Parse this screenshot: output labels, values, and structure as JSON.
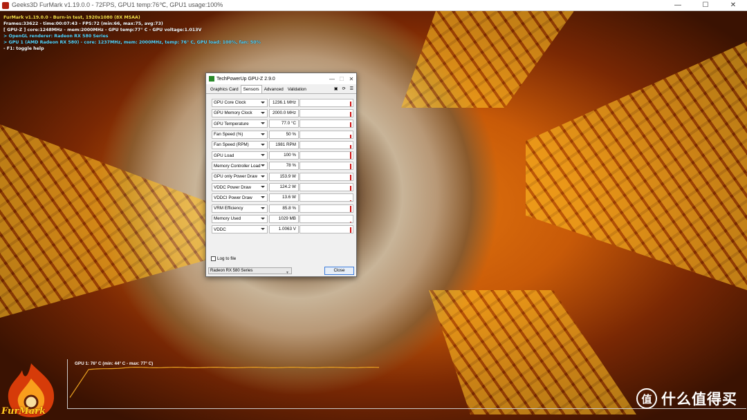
{
  "window": {
    "title": "Geeks3D FurMark v1.19.0.0 - 72FPS, GPU1 temp:76℃, GPU1 usage:100%",
    "controls": [
      "—",
      "☐",
      "✕"
    ]
  },
  "overlay": {
    "lines": [
      "FurMark v1.19.0.0 - Burn-in test, 1920x1080 (8X MSAA)",
      "Frames:33622 - time:00:07:43 - FPS:72 (min:66, max:75, avg:73)",
      "[ GPU-Z ] core:1248MHz - mem:2000MHz - GPU temp:77° C - GPU voltage:1.013V",
      "> OpenGL renderer: Radeon RX 580 Series",
      "> GPU 1 (AMD Radeon RX 580) - core: 1237MHz, mem: 2000MHz, temp: 76° C, GPU load: 100%, fan: 50%",
      "- F1: toggle help"
    ]
  },
  "gpuz": {
    "title": "TechPowerUp GPU-Z 2.9.0",
    "tabs": [
      "Graphics Card",
      "Sensors",
      "Advanced",
      "Validation"
    ],
    "active_tab": "Sensors",
    "sensors": [
      {
        "name": "GPU Core Clock",
        "value": "1236.1 MHz",
        "level": 0.7
      },
      {
        "name": "GPU Memory Clock",
        "value": "2000.0 MHz",
        "level": 0.7
      },
      {
        "name": "GPU Temperature",
        "value": "77.0 °C",
        "level": 0.7
      },
      {
        "name": "Fan Speed (%)",
        "value": "50 %",
        "level": 0.5
      },
      {
        "name": "Fan Speed (RPM)",
        "value": "1981 RPM",
        "level": 0.5
      },
      {
        "name": "GPU Load",
        "value": "100 %",
        "level": 1.0
      },
      {
        "name": "Memory Controller Load",
        "value": "78 %",
        "level": 0.78
      },
      {
        "name": "GPU only Power Draw",
        "value": "153.9 W",
        "level": 0.8
      },
      {
        "name": "VDDC Power Draw",
        "value": "124.2 W",
        "level": 0.7
      },
      {
        "name": "VDDCI Power Draw",
        "value": "13.6 W",
        "level": 0.1
      },
      {
        "name": "VRM Efficiency",
        "value": "85.8 %",
        "level": 0.85
      },
      {
        "name": "Memory Used",
        "value": "1029 MB",
        "level": 0.12
      },
      {
        "name": "VDDC",
        "value": "1.0063 V",
        "level": 0.8
      }
    ],
    "log_label": "Log to file",
    "gpu_select": "Radeon RX 580 Series",
    "close_label": "Close"
  },
  "temp_graph": {
    "label": "GPU 1: 76° C (min: 44° C - max: 77° C)",
    "color": "#e8a020"
  },
  "logo": {
    "text": "FurMark"
  },
  "watermark": {
    "badge": "值",
    "text": "什么值得买"
  }
}
